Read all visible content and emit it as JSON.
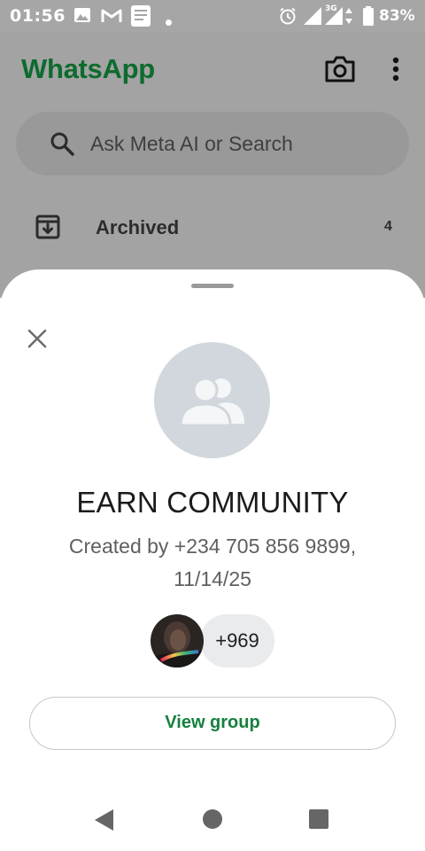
{
  "status_bar": {
    "time": "01:56",
    "network": "3G",
    "battery": "83%",
    "icons": [
      "gallery-icon",
      "gmail-icon",
      "notification-icon",
      "dot-icon",
      "alarm-icon",
      "signal-icon",
      "battery-icon"
    ]
  },
  "app": {
    "title": "WhatsApp",
    "brand_color": "#0d6b2e",
    "search": {
      "placeholder": "Ask Meta AI or Search"
    },
    "archived": {
      "label": "Archived",
      "count": "4"
    }
  },
  "sheet": {
    "group_name": "EARN COMMUNITY",
    "created_by": "Created by +234 705 856 9899, 11/14/25",
    "member_count": "+969",
    "view_button_label": "View group",
    "accent_color": "#15803d"
  }
}
